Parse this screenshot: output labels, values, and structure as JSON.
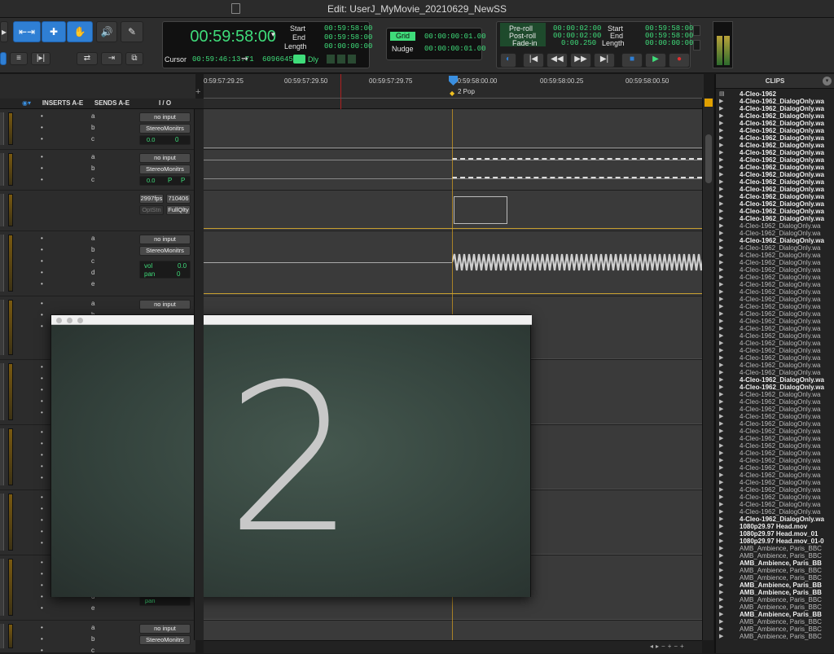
{
  "window": {
    "title": "Edit: UserJ_MyMovie_20210629_NewSS"
  },
  "transport": {
    "main_counter": "00:59:58:00",
    "start_label": "Start",
    "end_label": "End",
    "length_label": "Length",
    "start": "00:59:58:00",
    "end": "00:59:58:00",
    "length": "00:00:00:00",
    "cursor_label": "Cursor",
    "cursor": "00:59:46:13.71",
    "sample": "6096645",
    "dly_label": "Dly",
    "grid_label": "Grid",
    "grid": "00:00:00:01.00",
    "nudge_label": "Nudge",
    "nudge": "00:00:00:01.00",
    "preroll_label": "Pre-roll",
    "preroll": "00:00:02:00",
    "postroll_label": "Post-roll",
    "postroll": "00:00:02:00",
    "fadein_label": "Fade-in",
    "fadein": "0:00.250",
    "sel_start": "00:59:58:00",
    "sel_end": "00:59:58:00",
    "sel_length": "00:00:00:00"
  },
  "timeline": {
    "ticks": [
      "0:59:57:29.25",
      "00:59:57:29.50",
      "00:59:57:29.75",
      "00:59:58:00.00",
      "00:59:58:00.25",
      "00:59:58:00.50"
    ],
    "marker": "2 Pop"
  },
  "columns": {
    "inserts": "INSERTS A-E",
    "sends": "SENDS A-E",
    "io": "I / O"
  },
  "io": {
    "no_input": "no input",
    "stereo": "StereoMonitrs",
    "stereo_dim": "StereoMonitrs",
    "vol_zero": "0.0",
    "pan_zero": "0",
    "p": "P",
    "fps": "2997fps",
    "tc": "710406",
    "optstn": "OptStn",
    "fullqlty": "FullQlty",
    "vol_label": "vol",
    "pan_label": "pan",
    "pan_short": "pan"
  },
  "sends": [
    "a",
    "b",
    "c",
    "d",
    "e"
  ],
  "clips": {
    "header": "CLIPS",
    "items": [
      {
        "n": "4-Cleo-1962",
        "b": true,
        "i": "doc"
      },
      {
        "n": "4-Cleo-1962_DialogOnly.wa",
        "b": true
      },
      {
        "n": "4-Cleo-1962_DialogOnly.wa",
        "b": true
      },
      {
        "n": "4-Cleo-1962_DialogOnly.wa",
        "b": true
      },
      {
        "n": "4-Cleo-1962_DialogOnly.wa",
        "b": true
      },
      {
        "n": "4-Cleo-1962_DialogOnly.wa",
        "b": true
      },
      {
        "n": "4-Cleo-1962_DialogOnly.wa",
        "b": true
      },
      {
        "n": "4-Cleo-1962_DialogOnly.wa",
        "b": true
      },
      {
        "n": "4-Cleo-1962_DialogOnly.wa",
        "b": true
      },
      {
        "n": "4-Cleo-1962_DialogOnly.wa",
        "b": true
      },
      {
        "n": "4-Cleo-1962_DialogOnly.wa",
        "b": true
      },
      {
        "n": "4-Cleo-1962_DialogOnly.wa",
        "b": true
      },
      {
        "n": "4-Cleo-1962_DialogOnly.wa",
        "b": true
      },
      {
        "n": "4-Cleo-1962_DialogOnly.wa",
        "b": true
      },
      {
        "n": "4-Cleo-1962_DialogOnly.wa",
        "b": true
      },
      {
        "n": "4-Cleo-1962_DialogOnly.wa",
        "b": true
      },
      {
        "n": "4-Cleo-1962_DialogOnly.wa",
        "b": true
      },
      {
        "n": "4-Cleo-1962_DialogOnly.wa",
        "b": true
      },
      {
        "n": "4-Cleo-1962_DialogOnly.wa",
        "b": false
      },
      {
        "n": "4-Cleo-1962_DialogOnly.wa",
        "b": false
      },
      {
        "n": "4-Cleo-1962_DialogOnly.wa",
        "b": true
      },
      {
        "n": "4-Cleo-1962_DialogOnly.wa",
        "b": false
      },
      {
        "n": "4-Cleo-1962_DialogOnly.wa",
        "b": false
      },
      {
        "n": "4-Cleo-1962_DialogOnly.wa",
        "b": false
      },
      {
        "n": "4-Cleo-1962_DialogOnly.wa",
        "b": false
      },
      {
        "n": "4-Cleo-1962_DialogOnly.wa",
        "b": false
      },
      {
        "n": "4-Cleo-1962_DialogOnly.wa",
        "b": false
      },
      {
        "n": "4-Cleo-1962_DialogOnly.wa",
        "b": false
      },
      {
        "n": "4-Cleo-1962_DialogOnly.wa",
        "b": false
      },
      {
        "n": "4-Cleo-1962_DialogOnly.wa",
        "b": false
      },
      {
        "n": "4-Cleo-1962_DialogOnly.wa",
        "b": false
      },
      {
        "n": "4-Cleo-1962_DialogOnly.wa",
        "b": false
      },
      {
        "n": "4-Cleo-1962_DialogOnly.wa",
        "b": false
      },
      {
        "n": "4-Cleo-1962_DialogOnly.wa",
        "b": false
      },
      {
        "n": "4-Cleo-1962_DialogOnly.wa",
        "b": false
      },
      {
        "n": "4-Cleo-1962_DialogOnly.wa",
        "b": false
      },
      {
        "n": "4-Cleo-1962_DialogOnly.wa",
        "b": false
      },
      {
        "n": "4-Cleo-1962_DialogOnly.wa",
        "b": false
      },
      {
        "n": "4-Cleo-1962_DialogOnly.wa",
        "b": false
      },
      {
        "n": "4-Cleo-1962_DialogOnly.wa",
        "b": true
      },
      {
        "n": "4-Cleo-1962_DialogOnly.wa",
        "b": true
      },
      {
        "n": "4-Cleo-1962_DialogOnly.wa",
        "b": false
      },
      {
        "n": "4-Cleo-1962_DialogOnly.wa",
        "b": false
      },
      {
        "n": "4-Cleo-1962_DialogOnly.wa",
        "b": false
      },
      {
        "n": "4-Cleo-1962_DialogOnly.wa",
        "b": false
      },
      {
        "n": "4-Cleo-1962_DialogOnly.wa",
        "b": false
      },
      {
        "n": "4-Cleo-1962_DialogOnly.wa",
        "b": false
      },
      {
        "n": "4-Cleo-1962_DialogOnly.wa",
        "b": false
      },
      {
        "n": "4-Cleo-1962_DialogOnly.wa",
        "b": false
      },
      {
        "n": "4-Cleo-1962_DialogOnly.wa",
        "b": false
      },
      {
        "n": "4-Cleo-1962_DialogOnly.wa",
        "b": false
      },
      {
        "n": "4-Cleo-1962_DialogOnly.wa",
        "b": false
      },
      {
        "n": "4-Cleo-1962_DialogOnly.wa",
        "b": false
      },
      {
        "n": "4-Cleo-1962_DialogOnly.wa",
        "b": false
      },
      {
        "n": "4-Cleo-1962_DialogOnly.wa",
        "b": false
      },
      {
        "n": "4-Cleo-1962_DialogOnly.wa",
        "b": false
      },
      {
        "n": "4-Cleo-1962_DialogOnly.wa",
        "b": false
      },
      {
        "n": "4-Cleo-1962_DialogOnly.wa",
        "b": false
      },
      {
        "n": "4-Cleo-1962_DialogOnly.wa",
        "b": true
      },
      {
        "n": "1080p29.97 Head.mov",
        "b": true
      },
      {
        "n": "1080p29.97 Head.mov_01",
        "b": true
      },
      {
        "n": "1080p29.97 Head.mov_01-0",
        "b": true
      },
      {
        "n": "AMB_Ambience, Paris_BBC",
        "b": false
      },
      {
        "n": "AMB_Ambience, Paris_BBC",
        "b": false
      },
      {
        "n": "AMB_Ambience, Paris_BB",
        "b": true
      },
      {
        "n": "AMB_Ambience, Paris_BBC",
        "b": false
      },
      {
        "n": "AMB_Ambience, Paris_BBC",
        "b": false
      },
      {
        "n": "AMB_Ambience, Paris_BB",
        "b": true
      },
      {
        "n": "AMB_Ambience, Paris_BB",
        "b": true
      },
      {
        "n": "AMB_Ambience, Paris_BBC",
        "b": false
      },
      {
        "n": "AMB_Ambience, Paris_BBC",
        "b": false
      },
      {
        "n": "AMB_Ambience, Paris_BB",
        "b": true
      },
      {
        "n": "AMB_Ambience, Paris_BBC",
        "b": false
      },
      {
        "n": "AMB_Ambience, Paris_BBC",
        "b": false
      },
      {
        "n": "AMB_Ambience, Paris_BBC",
        "b": false
      }
    ]
  },
  "video": {
    "countdown": "2"
  }
}
